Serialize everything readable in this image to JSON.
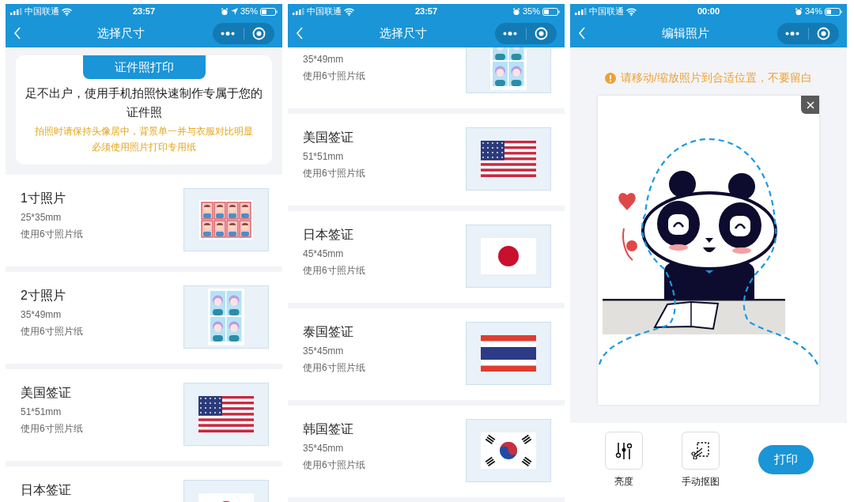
{
  "screens": [
    {
      "kind": "list",
      "status": {
        "carrier": "中国联通",
        "time": "23:57",
        "battery": "35%",
        "location": true
      },
      "title": "选择尺寸",
      "banner": {
        "tab": "证件照打印",
        "text": "足不出户，使用手机拍照快速制作专属于您的证件照",
        "notes": [
          "拍照时请保持头像居中，背景单一并与衣服对比明显",
          "必须使用照片打印专用纸"
        ]
      },
      "items": [
        {
          "title": "1寸照片",
          "size": "25*35mm",
          "paper": "使用6寸照片纸",
          "kind": "sheet8"
        },
        {
          "title": "2寸照片",
          "size": "35*49mm",
          "paper": "使用6寸照片纸",
          "kind": "sheet4"
        },
        {
          "title": "美国签证",
          "size": "51*51mm",
          "paper": "使用6寸照片纸",
          "kind": "stripes"
        },
        {
          "title": "日本签证",
          "kind": "disc"
        }
      ]
    },
    {
      "kind": "list",
      "status": {
        "carrier": "中国联通",
        "time": "23:57",
        "battery": "35%",
        "location": false
      },
      "title": "选择尺寸",
      "items": [
        {
          "size": "35*49mm",
          "paper": "使用6寸照片纸",
          "kind": "sheet4",
          "scrolled": true
        },
        {
          "title": "美国签证",
          "size": "51*51mm",
          "paper": "使用6寸照片纸",
          "kind": "stripes"
        },
        {
          "title": "日本签证",
          "size": "45*45mm",
          "paper": "使用6寸照片纸",
          "kind": "disc"
        },
        {
          "title": "泰国签证",
          "size": "35*45mm",
          "paper": "使用6寸照片纸",
          "kind": "bands"
        },
        {
          "title": "韩国签证",
          "size": "35*45mm",
          "paper": "使用6寸照片纸",
          "kind": "taegeuk"
        }
      ]
    },
    {
      "kind": "editor",
      "status": {
        "carrier": "中国联通",
        "time": "00:00",
        "battery": "34%",
        "location": false
      },
      "title": "编辑照片",
      "hint": "请移动/缩放照片到合适位置，不要留白",
      "tools": [
        {
          "label": "亮度",
          "kind": "sliders"
        },
        {
          "label": "手动抠图",
          "kind": "crop"
        }
      ],
      "action": "打印"
    }
  ]
}
